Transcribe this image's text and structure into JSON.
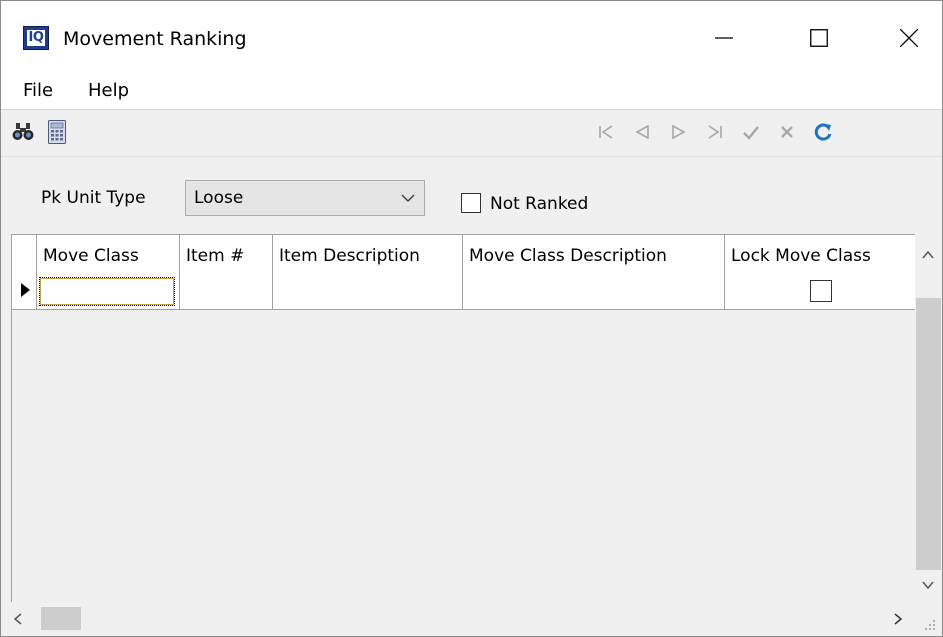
{
  "window": {
    "title": "Movement Ranking",
    "app_icon_text": "IQ",
    "controls": [
      "minimize-icon",
      "maximize-icon",
      "close-icon"
    ]
  },
  "menu": {
    "items": [
      {
        "label": "File"
      },
      {
        "label": "Help"
      }
    ]
  },
  "toolbar": {
    "left_icons": [
      "binoculars-icon",
      "calculator-icon"
    ],
    "nav_icons": [
      "first-record-icon",
      "prev-record-icon",
      "next-record-icon",
      "last-record-icon",
      "post-check-icon",
      "cancel-x-icon",
      "refresh-icon"
    ]
  },
  "filter": {
    "pk_unit_type_label": "Pk Unit Type",
    "pk_unit_type_value": "Loose",
    "not_ranked_label": "Not Ranked",
    "not_ranked_checked": false
  },
  "grid": {
    "columns": [
      {
        "label": "Move Class"
      },
      {
        "label": "Item #"
      },
      {
        "label": "Item Description"
      },
      {
        "label": "Move Class Description"
      },
      {
        "label": "Lock Move Class"
      }
    ],
    "rows": [
      {
        "move_class": "",
        "item_no": "",
        "item_description": "",
        "move_class_description": "",
        "lock_move_class": false
      }
    ]
  },
  "colors": {
    "app_icon_blue": "#1f3d8c",
    "refresh_blue": "#1a73c8",
    "disabled_gray": "#a8a8a8",
    "window_bg": "#f0f0f0"
  }
}
